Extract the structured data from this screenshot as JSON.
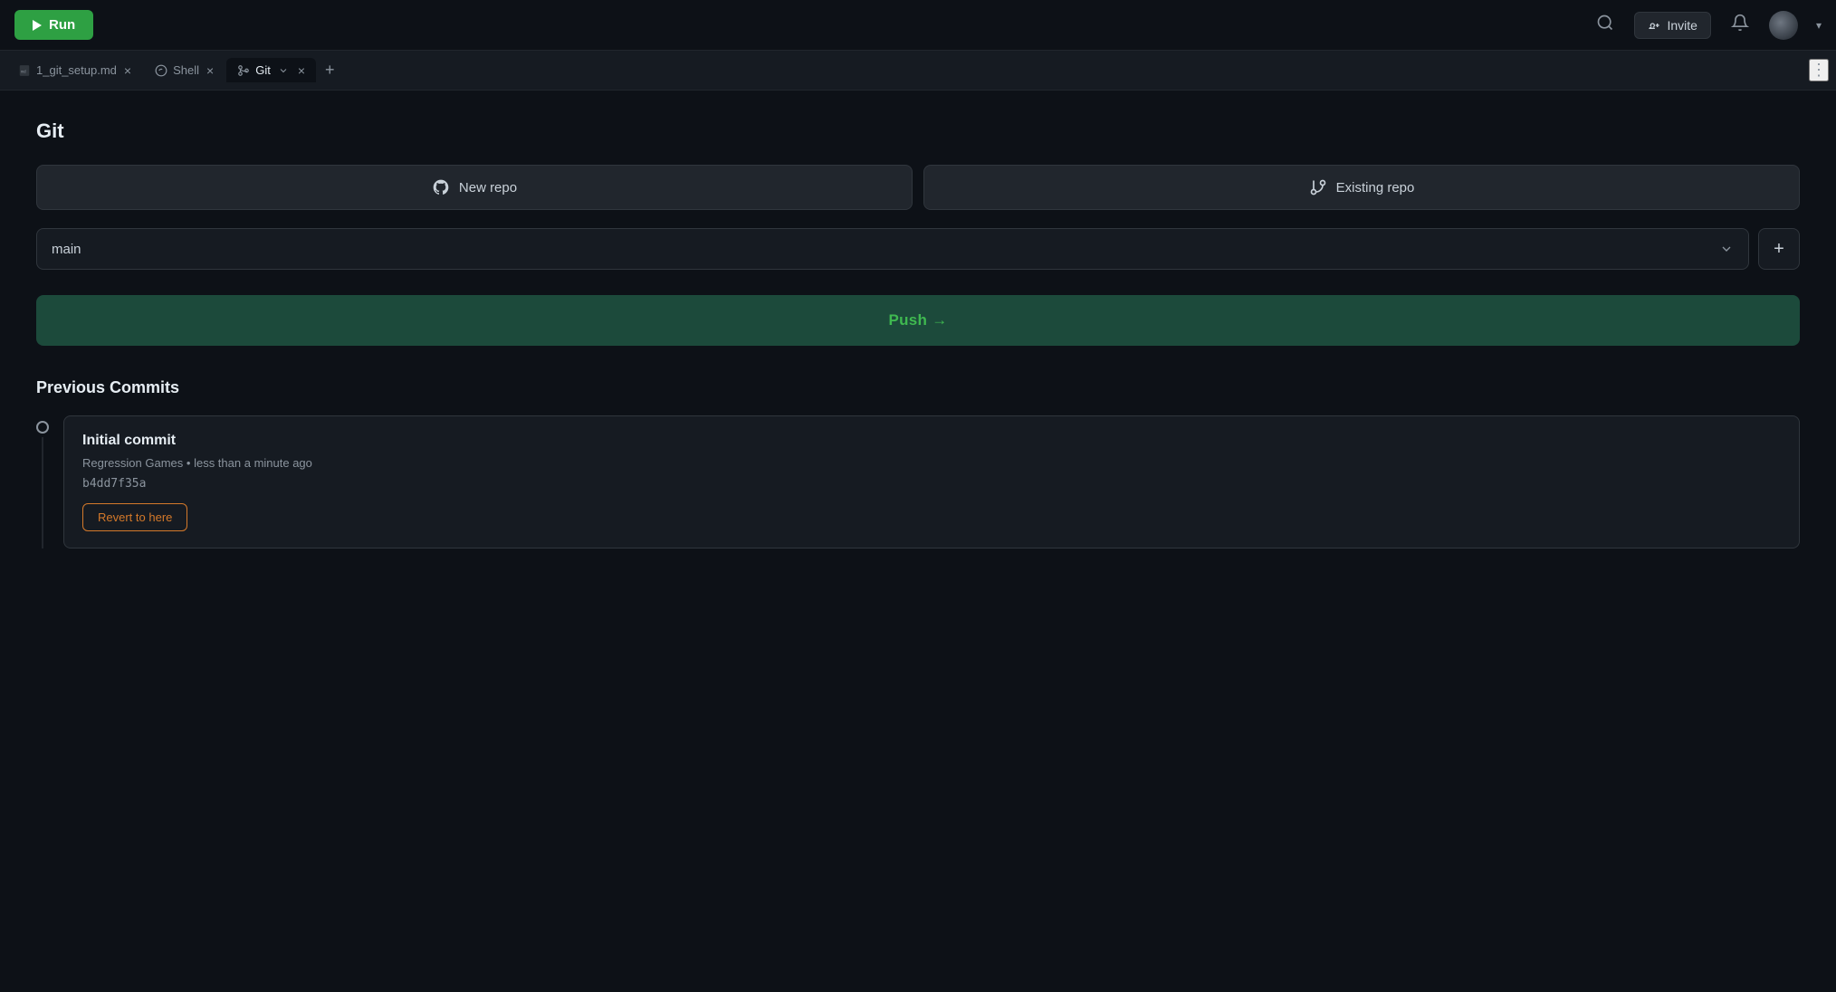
{
  "topbar": {
    "run_label": "Run",
    "invite_label": "Invite",
    "invite_icon": "person-add-icon"
  },
  "tabs": [
    {
      "id": "tab-md",
      "label": "1_git_setup.md",
      "icon": "md-icon",
      "active": false
    },
    {
      "id": "tab-shell",
      "label": "Shell",
      "icon": "shell-icon",
      "active": false
    },
    {
      "id": "tab-git",
      "label": "Git",
      "icon": "git-icon",
      "active": true
    }
  ],
  "git_panel": {
    "title": "Git",
    "new_repo_label": "New repo",
    "existing_repo_label": "Existing repo",
    "branch_name": "main",
    "push_label": "Push →",
    "previous_commits_title": "Previous Commits",
    "commits": [
      {
        "title": "Initial commit",
        "author": "Regression Games",
        "time": "less than a minute ago",
        "hash": "b4dd7f35a",
        "revert_label": "Revert to here"
      }
    ]
  }
}
